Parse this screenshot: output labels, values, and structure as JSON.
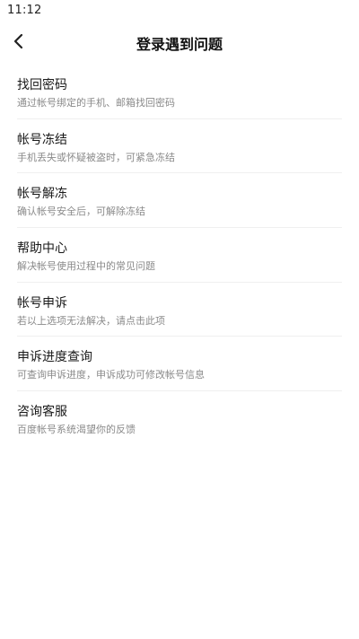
{
  "status_bar": {
    "time": "11:12"
  },
  "header": {
    "back_icon": "chevron-left-icon",
    "title": "登录遇到问题"
  },
  "menu": {
    "items": [
      {
        "title": "找回密码",
        "desc": "通过帐号绑定的手机、邮箱找回密码"
      },
      {
        "title": "帐号冻结",
        "desc": "手机丢失或怀疑被盗时，可紧急冻结"
      },
      {
        "title": "帐号解冻",
        "desc": "确认帐号安全后，可解除冻结"
      },
      {
        "title": "帮助中心",
        "desc": "解决帐号使用过程中的常见问题"
      },
      {
        "title": "帐号申诉",
        "desc": "若以上选项无法解决，请点击此项"
      },
      {
        "title": "申诉进度查询",
        "desc": "可查询申诉进度，申诉成功可修改帐号信息"
      },
      {
        "title": "咨询客服",
        "desc": "百度帐号系统渴望你的反馈"
      }
    ]
  },
  "colors": {
    "title_text": "#1a1a1a",
    "desc_text": "#8a8a8a",
    "divider": "#efefef",
    "background": "#ffffff"
  }
}
